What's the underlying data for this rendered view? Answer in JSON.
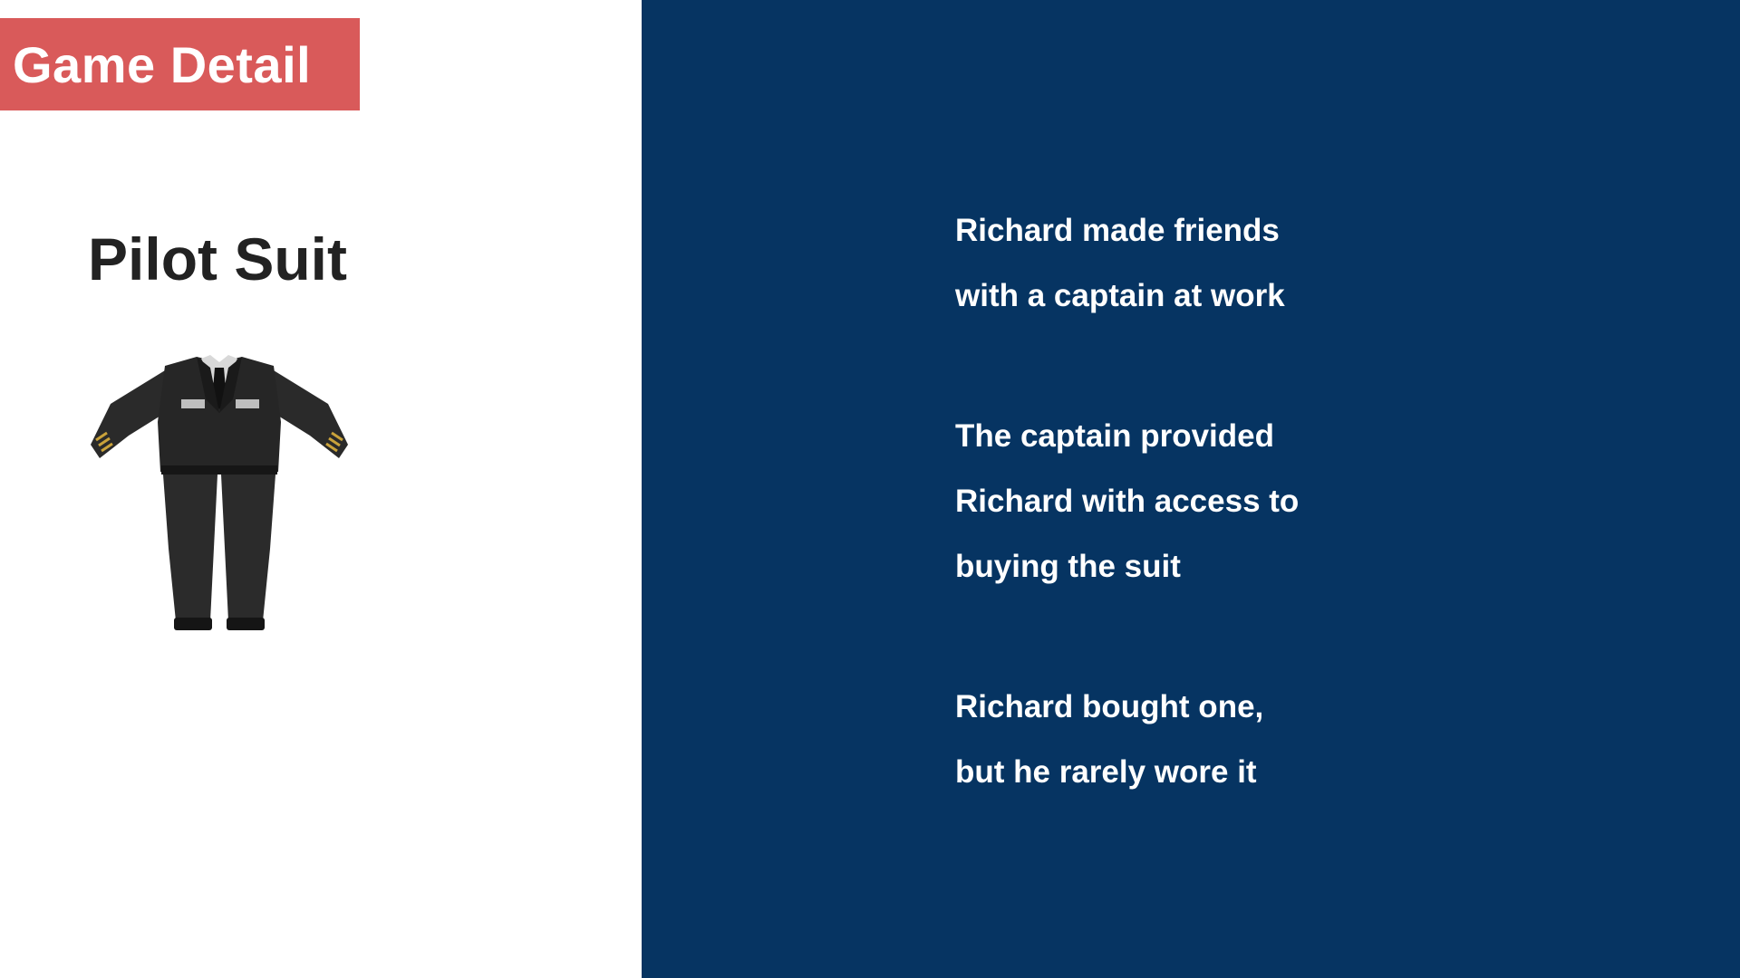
{
  "header": {
    "label": "Game Detail"
  },
  "item": {
    "name": "Pilot Suit",
    "image_icon": "pilot-suit-icon"
  },
  "story": {
    "paragraphs": [
      [
        "Richard made friends",
        "with a captain at work"
      ],
      [
        "The captain provided",
        "Richard with access to",
        "buying the suit"
      ],
      [
        "Richard bought one,",
        "but he rarely wore it"
      ]
    ]
  },
  "colors": {
    "header_bg": "#d95a5a",
    "panel_bg": "#063462",
    "title_text": "#222222",
    "story_text": "#ffffff"
  }
}
